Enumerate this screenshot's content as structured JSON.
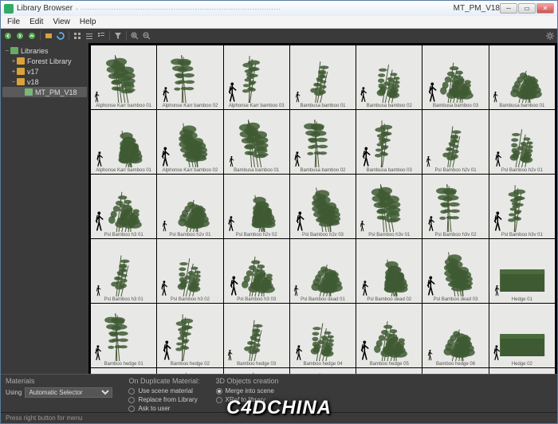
{
  "window": {
    "app_title": "Library Browser",
    "path_blur": "····················································································",
    "path_end": "MT_PM_V18"
  },
  "menu": {
    "file": "File",
    "edit": "Edit",
    "view": "View",
    "help": "Help"
  },
  "tree": {
    "root": "Libraries",
    "items": [
      {
        "label": "Forest Library",
        "indent": 1,
        "expanded": false
      },
      {
        "label": "v17",
        "indent": 1,
        "expanded": false
      },
      {
        "label": "v18",
        "indent": 1,
        "expanded": true
      },
      {
        "label": "MT_PM_V18",
        "indent": 2,
        "selected": true,
        "leaf": true
      }
    ]
  },
  "thumbs": [
    {
      "c": "Alphonse Karr bamboo 01"
    },
    {
      "c": "Alphonse Karr bamboo 02"
    },
    {
      "c": "Alphonse Karr bamboo 03"
    },
    {
      "c": "Bambusa bamboo 01"
    },
    {
      "c": "Bambusa bamboo 02"
    },
    {
      "c": "Bambusa bamboo 03"
    },
    {
      "c": "Bambusa bamboo 01"
    },
    {
      "c": "Alphonse Karr bamboo 01"
    },
    {
      "c": "Alphonse Karr bamboo 02"
    },
    {
      "c": "Bambusa bamboo 01"
    },
    {
      "c": "Bambusa bamboo 02"
    },
    {
      "c": "Bambusa bamboo 03"
    },
    {
      "c": "Psl Bamboo h2v 01"
    },
    {
      "c": "Psl Bamboo h2v 01"
    },
    {
      "c": "Psl Bamboo h3 01"
    },
    {
      "c": "Psl Bamboo h2v 01"
    },
    {
      "c": "Psl Bamboo h2v 02"
    },
    {
      "c": "Psl Bamboo h2v 03"
    },
    {
      "c": "Psl Bamboo h3v 01"
    },
    {
      "c": "Psl Bamboo h3v 02"
    },
    {
      "c": "Psl Bamboo h3v 01"
    },
    {
      "c": "Psl Bamboo h3 01"
    },
    {
      "c": "Psl Bamboo h3 02"
    },
    {
      "c": "Psl Bamboo h3 03"
    },
    {
      "c": "Psl Bamboo dead 01"
    },
    {
      "c": "Psl Bamboo dead 02"
    },
    {
      "c": "Psl Bamboo dead 03"
    },
    {
      "c": "Hedge 01"
    },
    {
      "c": "Bamboo hedge 01"
    },
    {
      "c": "Bamboo hedge 02"
    },
    {
      "c": "Bamboo hedge 03"
    },
    {
      "c": "Bamboo hedge 04"
    },
    {
      "c": "Bamboo hedge 05"
    },
    {
      "c": "Bamboo hedge 06"
    },
    {
      "c": "Hedge 02"
    },
    {
      "c": ""
    },
    {
      "c": ""
    },
    {
      "c": ""
    },
    {
      "c": ""
    },
    {
      "c": ""
    },
    {
      "c": ""
    },
    {
      "c": ""
    }
  ],
  "bottom": {
    "materials_hdr": "Materials",
    "using_label": "Using",
    "using_value": "Automatic Selector",
    "dup_hdr": "On Duplicate Material:",
    "dup_opts": {
      "use_scene": "Use scene material",
      "replace": "Replace from Library",
      "ask": "Ask to user"
    },
    "obj_hdr": "3D Objects creation",
    "obj_opts": {
      "merge": "Merge into scene",
      "xref": "XRef to library"
    }
  },
  "status": "Press right button for menu",
  "watermark": "C4DCHINA"
}
